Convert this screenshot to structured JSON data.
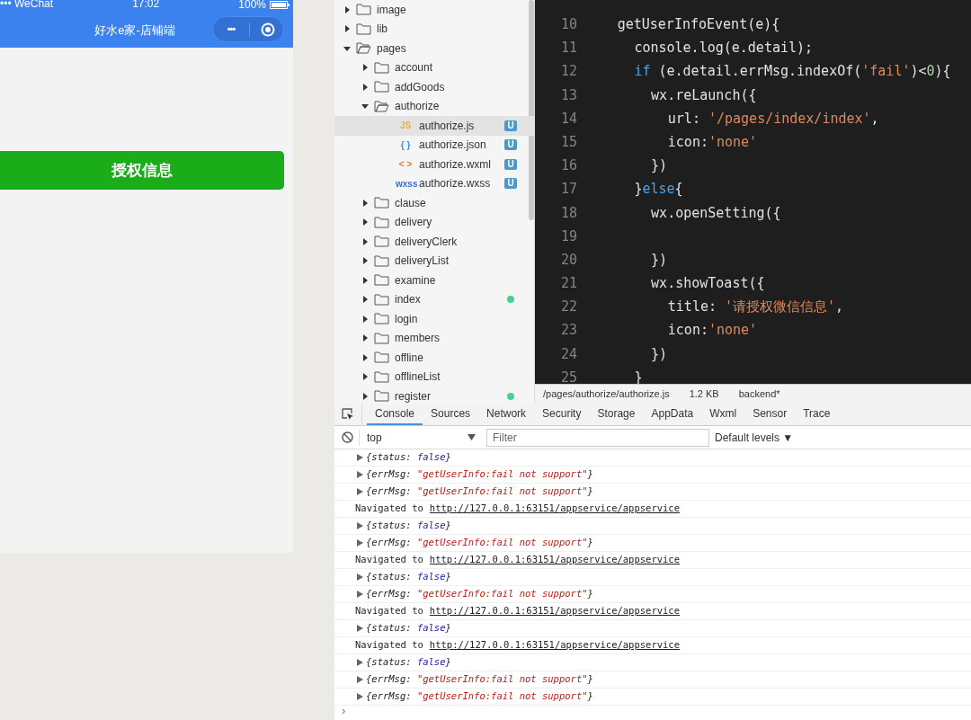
{
  "phone": {
    "status_bar": {
      "carrier": "••• WeChat",
      "time": "17:02",
      "battery": "100%"
    },
    "nav_title": "好水e家-店铺端",
    "capsule_more": "•••",
    "button": "授权信息"
  },
  "file_tree": [
    {
      "name": "image",
      "kind": "folder",
      "expanded": false,
      "selected": false
    },
    {
      "name": "lib",
      "kind": "folder",
      "expanded": false,
      "selected": false
    },
    {
      "name": "pages",
      "kind": "folder",
      "expanded": true,
      "selected": false,
      "children": [
        {
          "name": "account",
          "kind": "folder",
          "expanded": false,
          "selected": false
        },
        {
          "name": "addGoods",
          "kind": "folder",
          "expanded": false,
          "selected": false
        },
        {
          "name": "authorize",
          "kind": "folder",
          "expanded": true,
          "selected": false,
          "children": [
            {
              "name": "authorize.js",
              "kind": "file",
              "color": "#e8b732",
              "type_label": "JS",
              "badge": "U",
              "selected": true
            },
            {
              "name": "authorize.json",
              "kind": "file",
              "color": "#3a8ee6",
              "type_label": "{ }",
              "badge": "U",
              "selected": false
            },
            {
              "name": "authorize.wxml",
              "kind": "file",
              "color": "#e8743a",
              "type_label": "< >",
              "badge": "U",
              "selected": false
            },
            {
              "name": "authorize.wxss",
              "kind": "file",
              "color": "#3a6fd8",
              "type_label": "wxss",
              "badge": "U",
              "selected": false
            }
          ]
        },
        {
          "name": "clause",
          "kind": "folder",
          "expanded": false,
          "selected": false
        },
        {
          "name": "delivery",
          "kind": "folder",
          "expanded": false,
          "selected": false
        },
        {
          "name": "deliveryClerk",
          "kind": "folder",
          "expanded": false,
          "selected": false
        },
        {
          "name": "deliveryList",
          "kind": "folder",
          "expanded": false,
          "selected": false
        },
        {
          "name": "examine",
          "kind": "folder",
          "expanded": false,
          "selected": false
        },
        {
          "name": "index",
          "kind": "folder",
          "expanded": false,
          "selected": false,
          "changed": true
        },
        {
          "name": "login",
          "kind": "folder",
          "expanded": false,
          "selected": false
        },
        {
          "name": "members",
          "kind": "folder",
          "expanded": false,
          "selected": false
        },
        {
          "name": "offline",
          "kind": "folder",
          "expanded": false,
          "selected": false
        },
        {
          "name": "offlineList",
          "kind": "folder",
          "expanded": false,
          "selected": false
        },
        {
          "name": "register",
          "kind": "folder",
          "expanded": false,
          "selected": false,
          "changed": true
        }
      ]
    }
  ],
  "editor": {
    "lines": [
      {
        "number": "10",
        "tokens": [
          {
            "text": "getUserInfoEvent(e){",
            "kind": "plain"
          }
        ],
        "children": [
          {
            "number": "11",
            "tokens": [
              {
                "text": "console.log(e.detail);",
                "kind": "plain"
              }
            ]
          },
          {
            "number": "12",
            "tokens": [
              {
                "text": "if",
                "kind": "keyword"
              },
              {
                "text": " (e.detail.errMsg.indexOf(",
                "kind": "plain"
              },
              {
                "text": "'fail'",
                "kind": "string"
              },
              {
                "text": ")<",
                "kind": "plain"
              },
              {
                "text": "0",
                "kind": "number"
              },
              {
                "text": "){",
                "kind": "plain"
              }
            ],
            "children": [
              {
                "number": "13",
                "tokens": [
                  {
                    "text": "wx.reLaunch({",
                    "kind": "plain"
                  }
                ],
                "children": [
                  {
                    "number": "14",
                    "tokens": [
                      {
                        "text": "url: ",
                        "kind": "plain"
                      },
                      {
                        "text": "'/pages/index/index'",
                        "kind": "string"
                      },
                      {
                        "text": ",",
                        "kind": "plain"
                      }
                    ]
                  },
                  {
                    "number": "15",
                    "tokens": [
                      {
                        "text": "icon:",
                        "kind": "plain"
                      },
                      {
                        "text": "'none'",
                        "kind": "string"
                      }
                    ]
                  }
                ]
              },
              {
                "number": "16",
                "tokens": [
                  {
                    "text": "})",
                    "kind": "plain"
                  }
                ]
              }
            ]
          },
          {
            "number": "17",
            "tokens": [
              {
                "text": "}",
                "kind": "plain"
              },
              {
                "text": "else",
                "kind": "keyword"
              },
              {
                "text": "{",
                "kind": "plain"
              }
            ],
            "children": [
              {
                "number": "18",
                "tokens": [
                  {
                    "text": "wx.openSetting({",
                    "kind": "plain"
                  }
                ],
                "children": [
                  {
                    "number": "19"
                  }
                ]
              },
              {
                "number": "20",
                "tokens": [
                  {
                    "text": "})",
                    "kind": "plain"
                  }
                ]
              },
              {
                "number": "21",
                "tokens": [
                  {
                    "text": "wx.showToast({",
                    "kind": "plain"
                  }
                ],
                "children": [
                  {
                    "number": "22",
                    "tokens": [
                      {
                        "text": "title: ",
                        "kind": "plain"
                      },
                      {
                        "text": "'请授权微信信息'",
                        "kind": "string"
                      },
                      {
                        "text": ",",
                        "kind": "plain"
                      }
                    ]
                  },
                  {
                    "number": "23",
                    "tokens": [
                      {
                        "text": "icon:",
                        "kind": "plain"
                      },
                      {
                        "text": "'none'",
                        "kind": "string"
                      }
                    ]
                  }
                ]
              },
              {
                "number": "24",
                "tokens": [
                  {
                    "text": "})",
                    "kind": "plain"
                  }
                ]
              }
            ]
          },
          {
            "number": "25",
            "tokens": [
              {
                "text": "}",
                "kind": "plain"
              }
            ]
          }
        ]
      }
    ],
    "status": {
      "path": "/pages/authorize/authorize.js",
      "size": "1.2 KB",
      "branch": "backend*"
    }
  },
  "devtools": {
    "tabs": [
      {
        "label": "Console",
        "selected": true
      },
      {
        "label": "Sources",
        "selected": false
      },
      {
        "label": "Network",
        "selected": false
      },
      {
        "label": "Security",
        "selected": false
      },
      {
        "label": "Storage",
        "selected": false
      },
      {
        "label": "AppData",
        "selected": false
      },
      {
        "label": "Wxml",
        "selected": false
      },
      {
        "label": "Sensor",
        "selected": false
      },
      {
        "label": "Trace",
        "selected": false
      }
    ],
    "context": "top",
    "filter_placeholder": "Filter",
    "levels": "Default levels ▼",
    "console": [
      {
        "kind": "object",
        "prefix": "{status: ",
        "value": "false",
        "color": "#1a1aa6",
        "suffix": "}"
      },
      {
        "kind": "object",
        "prefix": "{errMsg: ",
        "value": "\"getUserInfo:fail not support\"",
        "color": "#c41a16",
        "suffix": "}"
      },
      {
        "kind": "object",
        "prefix": "{errMsg: ",
        "value": "\"getUserInfo:fail not support\"",
        "color": "#c41a16",
        "suffix": "}"
      },
      {
        "kind": "navigation",
        "text": "Navigated to",
        "link": "http://127.0.0.1:63151/appservice/appservice"
      },
      {
        "kind": "object",
        "prefix": "{status: ",
        "value": "false",
        "color": "#1a1aa6",
        "suffix": "}"
      },
      {
        "kind": "object",
        "prefix": "{errMsg: ",
        "value": "\"getUserInfo:fail not support\"",
        "color": "#c41a16",
        "suffix": "}"
      },
      {
        "kind": "navigation",
        "text": "Navigated to",
        "link": "http://127.0.0.1:63151/appservice/appservice"
      },
      {
        "kind": "object",
        "prefix": "{status: ",
        "value": "false",
        "color": "#1a1aa6",
        "suffix": "}"
      },
      {
        "kind": "object",
        "prefix": "{errMsg: ",
        "value": "\"getUserInfo:fail not support\"",
        "color": "#c41a16",
        "suffix": "}"
      },
      {
        "kind": "navigation",
        "text": "Navigated to",
        "link": "http://127.0.0.1:63151/appservice/appservice"
      },
      {
        "kind": "object",
        "prefix": "{status: ",
        "value": "false",
        "color": "#1a1aa6",
        "suffix": "}"
      },
      {
        "kind": "navigation",
        "text": "Navigated to",
        "link": "http://127.0.0.1:63151/appservice/appservice"
      },
      {
        "kind": "object",
        "prefix": "{status: ",
        "value": "false",
        "color": "#1a1aa6",
        "suffix": "}"
      },
      {
        "kind": "object",
        "prefix": "{errMsg: ",
        "value": "\"getUserInfo:fail not support\"",
        "color": "#c41a16",
        "suffix": "}"
      },
      {
        "kind": "object",
        "prefix": "{errMsg: ",
        "value": "\"getUserInfo:fail not support\"",
        "color": "#c41a16",
        "suffix": "}"
      }
    ],
    "prompt": "›"
  }
}
